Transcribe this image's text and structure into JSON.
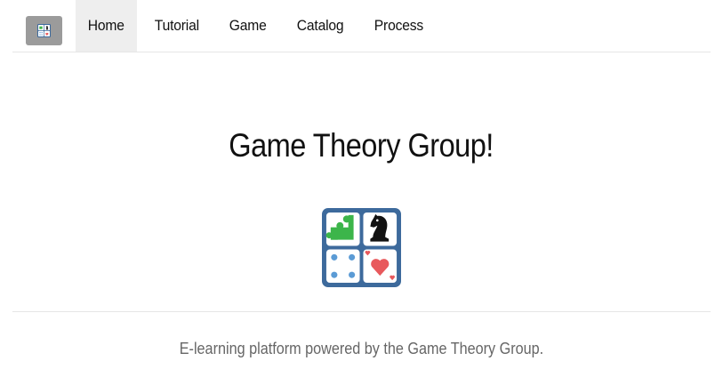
{
  "navbar": {
    "brand_icon": "games-logo-icon",
    "items": [
      {
        "label": "Home",
        "active": true
      },
      {
        "label": "Tutorial",
        "active": false
      },
      {
        "label": "Game",
        "active": false
      },
      {
        "label": "Catalog",
        "active": false
      },
      {
        "label": "Process",
        "active": false
      }
    ]
  },
  "hero": {
    "title": "Game Theory Group!",
    "logo_icon": "games-logo-icon"
  },
  "footer": {
    "text": "E-learning platform powered by the Game Theory Group."
  },
  "colors": {
    "logo_frame": "#3d6a9c",
    "puzzle": "#3cb54a",
    "dice_dots": "#5b9bd5",
    "heart": "#e8595c",
    "brand_bg": "#9b9b9b",
    "active_nav_bg": "#eeeeee"
  }
}
